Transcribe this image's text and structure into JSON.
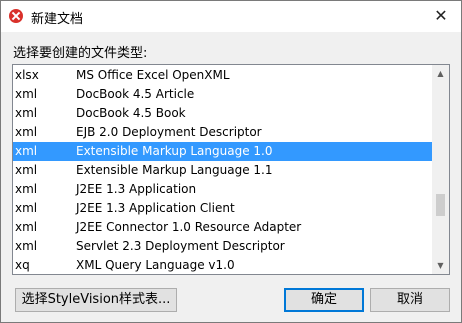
{
  "window": {
    "title": "新建文档",
    "close_glyph": "✕"
  },
  "prompt": "选择要创建的文件类型:",
  "file_types": [
    {
      "ext": "xlsx",
      "desc": "MS Office Excel OpenXML",
      "selected": false
    },
    {
      "ext": "xml",
      "desc": "DocBook 4.5 Article",
      "selected": false
    },
    {
      "ext": "xml",
      "desc": "DocBook 4.5 Book",
      "selected": false
    },
    {
      "ext": "xml",
      "desc": "EJB 2.0 Deployment Descriptor",
      "selected": false
    },
    {
      "ext": "xml",
      "desc": "Extensible Markup Language 1.0",
      "selected": true
    },
    {
      "ext": "xml",
      "desc": "Extensible Markup Language 1.1",
      "selected": false
    },
    {
      "ext": "xml",
      "desc": "J2EE 1.3 Application",
      "selected": false
    },
    {
      "ext": "xml",
      "desc": "J2EE 1.3 Application Client",
      "selected": false
    },
    {
      "ext": "xml",
      "desc": "J2EE Connector 1.0 Resource Adapter",
      "selected": false
    },
    {
      "ext": "xml",
      "desc": "Servlet 2.3 Deployment Descriptor",
      "selected": false
    },
    {
      "ext": "xq",
      "desc": "XML Query Language v1.0",
      "selected": false
    }
  ],
  "buttons": {
    "stylevision": "选择StyleVision样式表...",
    "ok": "确定",
    "cancel": "取消"
  },
  "scroll_glyphs": {
    "up": "▲",
    "down": "▼"
  },
  "colors": {
    "selection": "#3399ff",
    "default_button_border": "#0078d7"
  }
}
